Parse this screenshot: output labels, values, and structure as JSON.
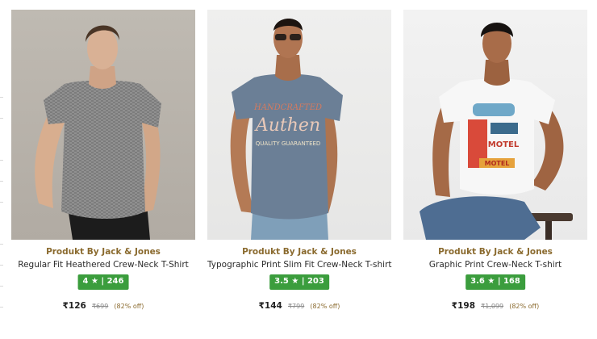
{
  "products": [
    {
      "brand": "Produkt By Jack & Jones",
      "title": "Regular Fit Heathered Crew-Neck T-Shirt",
      "rating": "4 ★ | 246",
      "price": "₹126",
      "mrp": "₹699",
      "discount": "(82% off)",
      "image": "man in grey heathered t-shirt and black trousers"
    },
    {
      "brand": "Produkt By Jack & Jones",
      "title": "Typographic Print Slim Fit Crew-Neck T-shirt",
      "rating": "3.5 ★ | 203",
      "price": "₹144",
      "mrp": "₹799",
      "discount": "(82% off)",
      "image": "man in blue-grey printed t-shirt with sunglasses"
    },
    {
      "brand": "Produkt By Jack & Jones",
      "title": "Graphic Print Crew-Neck T-shirt",
      "rating": "3.6 ★ | 168",
      "price": "₹198",
      "mrp": "₹1,099",
      "discount": "(82% off)",
      "image": "man in white graphic print t-shirt seated on stool"
    }
  ],
  "colors": {
    "brand_text": "#8a6a2e",
    "rating_badge": "#3b9d3d",
    "price_text": "#222222",
    "mrp_text": "#888888"
  }
}
